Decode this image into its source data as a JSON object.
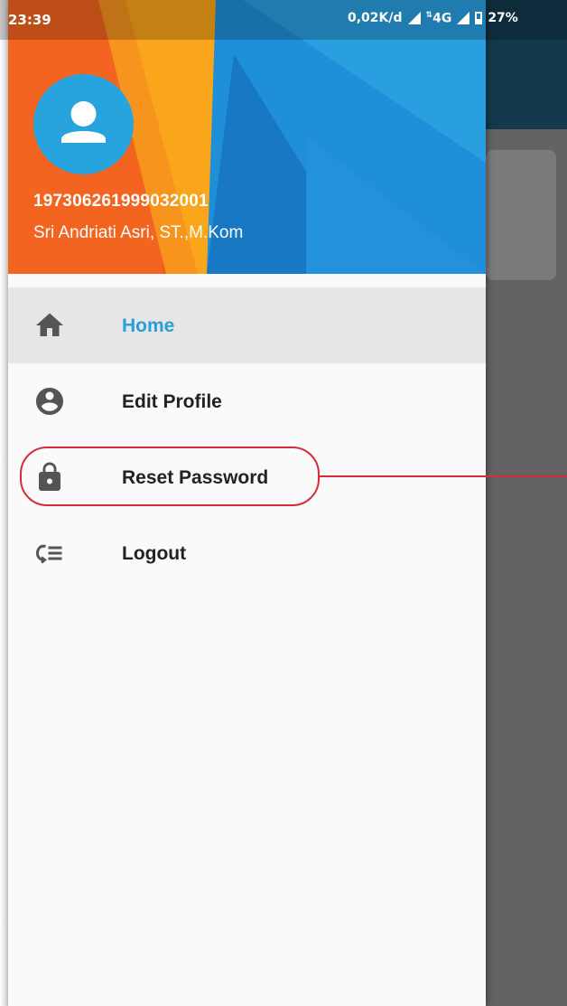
{
  "status_bar": {
    "time": "23:39",
    "network_speed": "0,02K/d",
    "network_type": "4G",
    "battery": "27%"
  },
  "profile": {
    "id": "197306261999032001",
    "name": "Sri Andriati Asri, ST.,M.Kom"
  },
  "menu": [
    {
      "label": "Home",
      "icon": "home-icon",
      "active": true
    },
    {
      "label": "Edit Profile",
      "icon": "account-circle-icon",
      "active": false
    },
    {
      "label": "Reset Password",
      "icon": "lock-icon",
      "active": false
    },
    {
      "label": "Logout",
      "icon": "logout-icon",
      "active": false
    }
  ],
  "colors": {
    "accent": "#2a9fd6",
    "header_orange": "#f0591f",
    "header_blue": "#1e8fd8",
    "avatar_bg": "#27a4dd",
    "annotation": "#d62b3a"
  }
}
